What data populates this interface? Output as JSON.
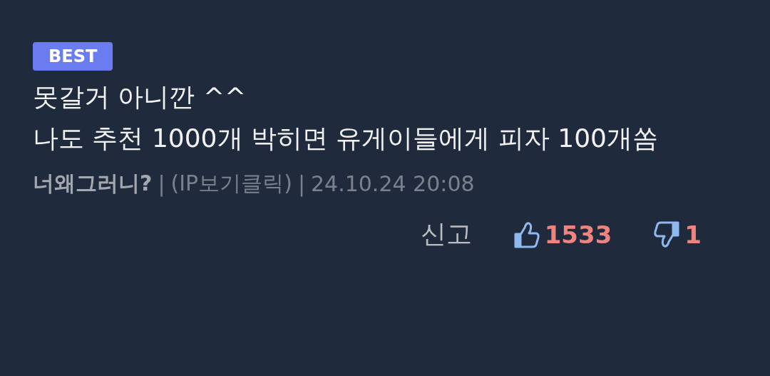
{
  "badge": "BEST",
  "body": "못갈거 아니깐 ^^\n나도 추천 1000개 박히면 유게이들에게 피자 100개쏨",
  "meta": {
    "author": "너왜그러니?",
    "separator_1": "|",
    "ip": "(IP보기클릭)",
    "separator_2": "|",
    "date": "24.10.24 20:08"
  },
  "actions": {
    "report": "신고",
    "upvotes": "1533",
    "downvotes": "1"
  }
}
